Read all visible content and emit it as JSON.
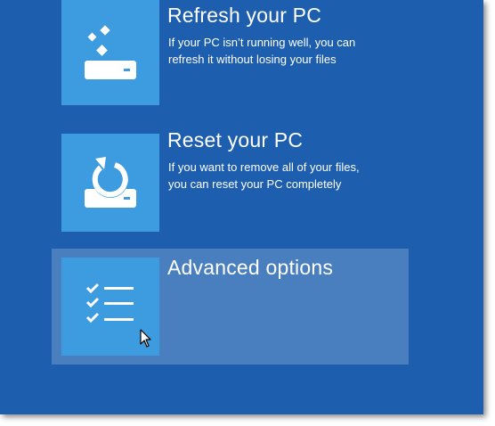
{
  "options": [
    {
      "title": "Refresh your PC",
      "desc_line1": "If your PC isn’t running well, you can",
      "desc_line2": "refresh it without losing your files",
      "icon": "refresh-drive-icon"
    },
    {
      "title": "Reset your PC",
      "desc_line1": "If you want to remove all of your files,",
      "desc_line2": "you can reset your PC completely",
      "icon": "reset-drive-icon"
    },
    {
      "title": "Advanced options",
      "icon": "checklist-icon",
      "selected": true
    }
  ],
  "colors": {
    "background": "#1d5fae",
    "tile": "#3d9be0",
    "selected_highlight": "#4a7fbf",
    "text": "#ffffff"
  },
  "cursor": "pointer-cursor-icon"
}
